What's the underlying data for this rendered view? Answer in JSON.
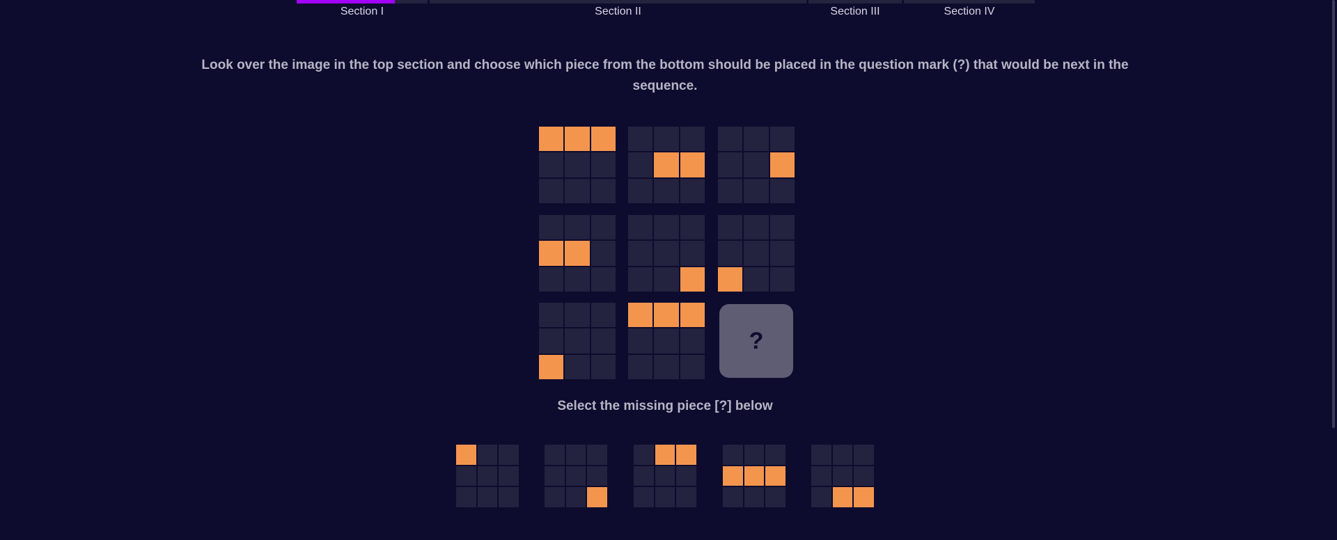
{
  "tabs": [
    {
      "label": "Section I",
      "active": true,
      "progress": 0.75
    },
    {
      "label": "Section II",
      "active": false,
      "progress": 0
    },
    {
      "label": "Section III",
      "active": false,
      "progress": 0
    },
    {
      "label": "Section IV",
      "active": false,
      "progress": 0
    }
  ],
  "instruction": "Look over the image in the top section and choose which piece from the bottom should be placed in the question mark (?) that would be next in the sequence.",
  "question_mark": "?",
  "subtitle": "Select the missing piece [?] below",
  "colors": {
    "background": "#0e0c2e",
    "cell_off": "#23223f",
    "cell_on": "#f4954e",
    "accent": "#a200ff",
    "question_tile": "#5e5d73"
  },
  "puzzle": [
    [
      1,
      1,
      1,
      0,
      0,
      0,
      0,
      0,
      0
    ],
    [
      0,
      0,
      0,
      0,
      1,
      1,
      0,
      0,
      0
    ],
    [
      0,
      0,
      0,
      0,
      0,
      1,
      0,
      0,
      0
    ],
    [
      0,
      0,
      0,
      1,
      1,
      0,
      0,
      0,
      0
    ],
    [
      0,
      0,
      0,
      0,
      0,
      0,
      0,
      0,
      1
    ],
    [
      0,
      0,
      0,
      0,
      0,
      0,
      1,
      0,
      0
    ],
    [
      0,
      0,
      0,
      0,
      0,
      0,
      1,
      0,
      0
    ],
    [
      1,
      1,
      1,
      0,
      0,
      0,
      0,
      0,
      0
    ],
    null
  ],
  "options": [
    [
      1,
      0,
      0,
      0,
      0,
      0,
      0,
      0,
      0
    ],
    [
      0,
      0,
      0,
      0,
      0,
      0,
      0,
      0,
      1
    ],
    [
      0,
      1,
      1,
      0,
      0,
      0,
      0,
      0,
      0
    ],
    [
      0,
      0,
      0,
      1,
      1,
      1,
      0,
      0,
      0
    ],
    [
      0,
      0,
      0,
      0,
      0,
      0,
      0,
      1,
      1
    ]
  ]
}
